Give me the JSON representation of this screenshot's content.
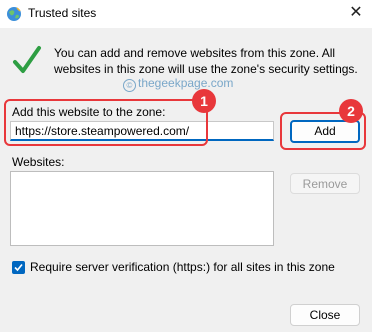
{
  "window": {
    "title": "Trusted sites",
    "close_glyph": "✕"
  },
  "info": {
    "text": "You can add and remove websites from this zone. All websites in this zone will use the zone's security settings."
  },
  "watermark": {
    "text": "thegeekpage.com",
    "icon": "©"
  },
  "add_section": {
    "label": "Add this website to the zone:",
    "value": "https://store.steampowered.com/",
    "add_button": "Add"
  },
  "websites": {
    "label": "Websites:",
    "items": [],
    "remove_button": "Remove"
  },
  "verification": {
    "checked": true,
    "label": "Require server verification (https:) for all sites in this zone"
  },
  "close_button": "Close",
  "annotations": {
    "badge1": "1",
    "badge2": "2"
  },
  "colors": {
    "accent": "#0067c0",
    "annotation": "#e8373b",
    "check_green": "#2e9e43"
  }
}
